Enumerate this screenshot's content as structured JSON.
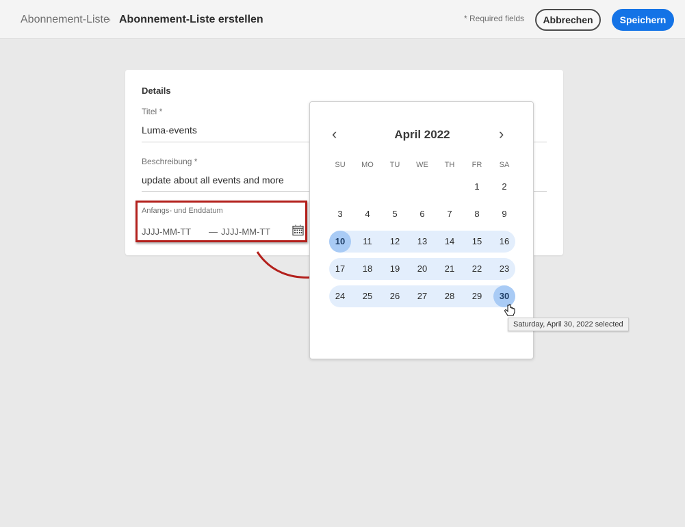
{
  "header": {
    "breadcrumb_parent": "Abonnement-Liste",
    "breadcrumb_current": "Abonnement-Liste erstellen",
    "required_note": "* Required fields",
    "cancel_label": "Abbrechen",
    "save_label": "Speichern"
  },
  "form": {
    "section_title": "Details",
    "title_label": "Titel",
    "title_value": "Luma-events",
    "desc_label": "Beschreibung",
    "desc_value": "update about all events and more",
    "required_mark": "*",
    "date_label": "Anfangs- und Enddatum",
    "start_placeholder": "JJJJ-MM-TT",
    "end_placeholder": "JJJJ-MM-TT",
    "range_dash": "—"
  },
  "calendar": {
    "month_label": "April 2022",
    "weekdays": [
      "SU",
      "MO",
      "TU",
      "WE",
      "TH",
      "FR",
      "SA"
    ],
    "weeks": [
      [
        null,
        null,
        null,
        null,
        null,
        1,
        2
      ],
      [
        3,
        4,
        5,
        6,
        7,
        8,
        9
      ],
      [
        10,
        11,
        12,
        13,
        14,
        15,
        16
      ],
      [
        17,
        18,
        19,
        20,
        21,
        22,
        23
      ],
      [
        24,
        25,
        26,
        27,
        28,
        29,
        30
      ]
    ],
    "range_start": 10,
    "range_end": 30
  },
  "tooltip": "Saturday, April 30, 2022 selected",
  "colors": {
    "accent": "#1473e6",
    "highlight": "#b3201c",
    "range": "#e3eefc",
    "selected": "#a9cbf5"
  }
}
